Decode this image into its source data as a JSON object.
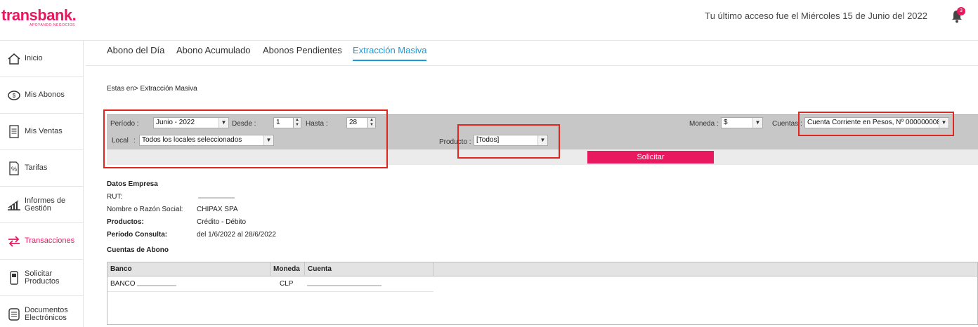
{
  "header": {
    "logo": "transbank.",
    "logo_tagline": "APOYANDO NEGOCIOS",
    "last_access": "Tu último acceso fue el Miércoles 15 de Junio del 2022",
    "notifications_count": "3",
    "brand_color": "#e8195e"
  },
  "sidebar": {
    "items": [
      {
        "label": "Inicio",
        "icon": "home-icon"
      },
      {
        "label": "Mis Abonos",
        "icon": "money-icon"
      },
      {
        "label": "Mis Ventas",
        "icon": "receipt-icon"
      },
      {
        "label": "Tarifas",
        "icon": "percent-icon"
      },
      {
        "label": "Informes de Gestión",
        "icon": "bar-chart-icon"
      },
      {
        "label": "Transacciones",
        "icon": "transfer-arrows-icon",
        "active": true
      },
      {
        "label": "Solicitar Productos",
        "icon": "pos-terminal-icon"
      },
      {
        "label": "Documentos Electrónicos",
        "icon": "document-icon"
      }
    ]
  },
  "tabs": [
    {
      "label": "Abono del Día"
    },
    {
      "label": "Abono Acumulado"
    },
    {
      "label": "Abonos Pendientes"
    },
    {
      "label": "Extracción Masiva",
      "active": true
    }
  ],
  "breadcrumb": "Estas en> Extracción Masiva",
  "filters": {
    "periodo_label": "Período :",
    "periodo_value": "Junio - 2022",
    "desde_label": "Desde :",
    "desde_value": "1",
    "hasta_label": "Hasta :",
    "hasta_value": "28",
    "local_label": "Local",
    "local_value": "Todos los locales seleccionados",
    "producto_label": "Producto :",
    "producto_value": "[Todos]",
    "moneda_label": "Moneda :",
    "moneda_value": "$",
    "cuentas_label": "Cuentas :",
    "cuentas_value": "Cuenta Corriente en Pesos, Nº 000000008",
    "submit_label": "Solicitar"
  },
  "empresa": {
    "title": "Datos Empresa",
    "rut_label": "RUT:",
    "razon_label": "Nombre o Razón Social:",
    "razon_value": "CHIPAX SPA",
    "productos_label": "Productos:",
    "productos_value": "Crédito - Débito",
    "periodo_label": "Período Consulta:",
    "periodo_value": "del 1/6/2022 al 28/6/2022"
  },
  "cuentas": {
    "title": "Cuentas de Abono",
    "columns": [
      "Banco",
      "Moneda",
      "Cuenta"
    ],
    "rows": [
      {
        "banco": "BANCO",
        "moneda": "CLP"
      }
    ]
  }
}
